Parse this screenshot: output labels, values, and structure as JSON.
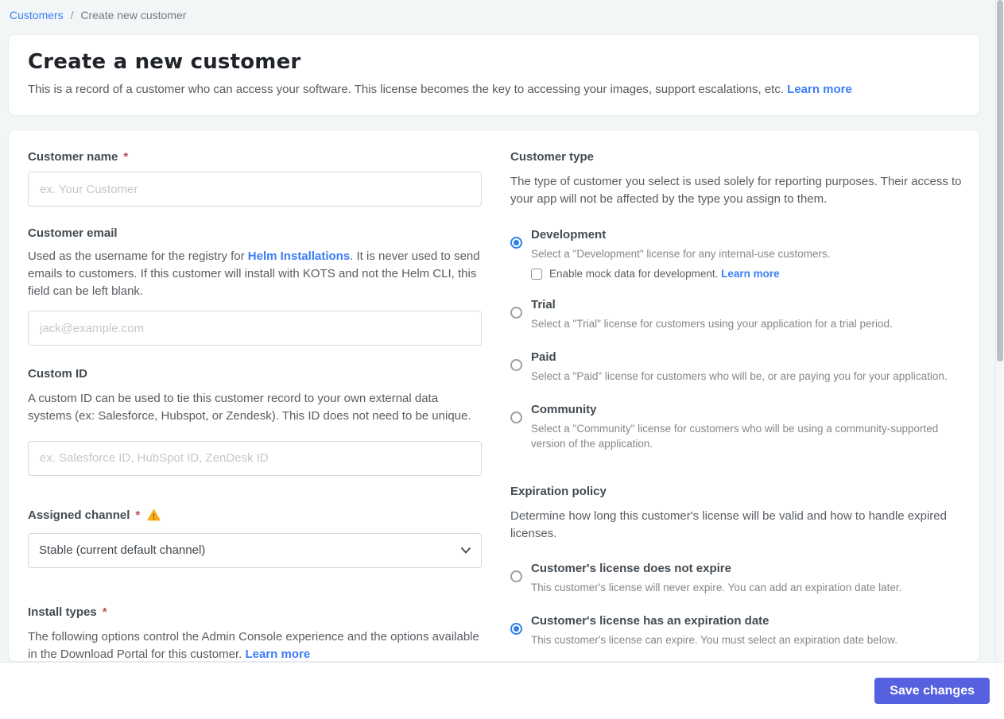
{
  "breadcrumb": {
    "link": "Customers",
    "separator": "/",
    "current": "Create new customer"
  },
  "header": {
    "title": "Create a new customer",
    "description": "This is a record of a customer who can access your software. This license becomes the key to accessing your images, support escalations, etc. ",
    "learn_more": "Learn more"
  },
  "required_marker": "*",
  "form": {
    "customer_name": {
      "label": "Customer name",
      "placeholder": "ex. Your Customer",
      "value": ""
    },
    "customer_email": {
      "label": "Customer email",
      "description_before": "Used as the username for the registry for ",
      "description_link": "Helm Installations",
      "description_after": ". It is never used to send emails to customers. If this customer will install with KOTS and not the Helm CLI, this field can be left blank.",
      "placeholder": "jack@example.com",
      "value": ""
    },
    "custom_id": {
      "label": "Custom ID",
      "description": "A custom ID can be used to tie this customer record to your own external data systems (ex: Salesforce, Hubspot, or Zendesk). This ID does not need to be unique.",
      "placeholder": "ex. Salesforce ID, HubSpot ID, ZenDesk ID",
      "value": ""
    },
    "assigned_channel": {
      "label": "Assigned channel",
      "selected_option": "Stable (current default channel)",
      "has_warning": true
    },
    "install_types": {
      "label": "Install types",
      "description": "The following options control the Admin Console experience and the options available in the Download Portal for this customer. ",
      "learn_more": "Learn more"
    }
  },
  "customer_type": {
    "label": "Customer type",
    "description": "The type of customer you select is used solely for reporting purposes. Their access to your app will not be affected by the type you assign to them.",
    "options": [
      {
        "title": "Development",
        "description": "Select a \"Development\" license for any internal-use customers.",
        "selected": true
      },
      {
        "title": "Trial",
        "description": "Select a \"Trial\" license for customers using your application for a trial period.",
        "selected": false
      },
      {
        "title": "Paid",
        "description": "Select a \"Paid\" license for customers who will be, or are paying you for your application.",
        "selected": false
      },
      {
        "title": "Community",
        "description": "Select a \"Community\" license for customers who will be using a community-supported version of the application.",
        "selected": false
      }
    ],
    "mock_data_checkbox": {
      "label": "Enable mock data for development. ",
      "learn_more": "Learn more",
      "checked": false
    }
  },
  "expiration_policy": {
    "label": "Expiration policy",
    "description": "Determine how long this customer's license will be valid and how to handle expired licenses.",
    "options": [
      {
        "title": "Customer's license does not expire",
        "description": "This customer's license will never expire. You can add an expiration date later.",
        "selected": false
      },
      {
        "title": "Customer's license has an expiration date",
        "description": "This customer's license can expire. You must select an expiration date below.",
        "selected": true
      }
    ]
  },
  "footer": {
    "save_label": "Save changes"
  },
  "colors": {
    "link_blue": "#3b7df8",
    "radio_selected_blue": "#2f80ed",
    "save_button_indigo": "#5661e0",
    "warning_amber": "#f8ae1a",
    "required_red": "#bc4b51",
    "page_background": "#f3f6f7"
  }
}
